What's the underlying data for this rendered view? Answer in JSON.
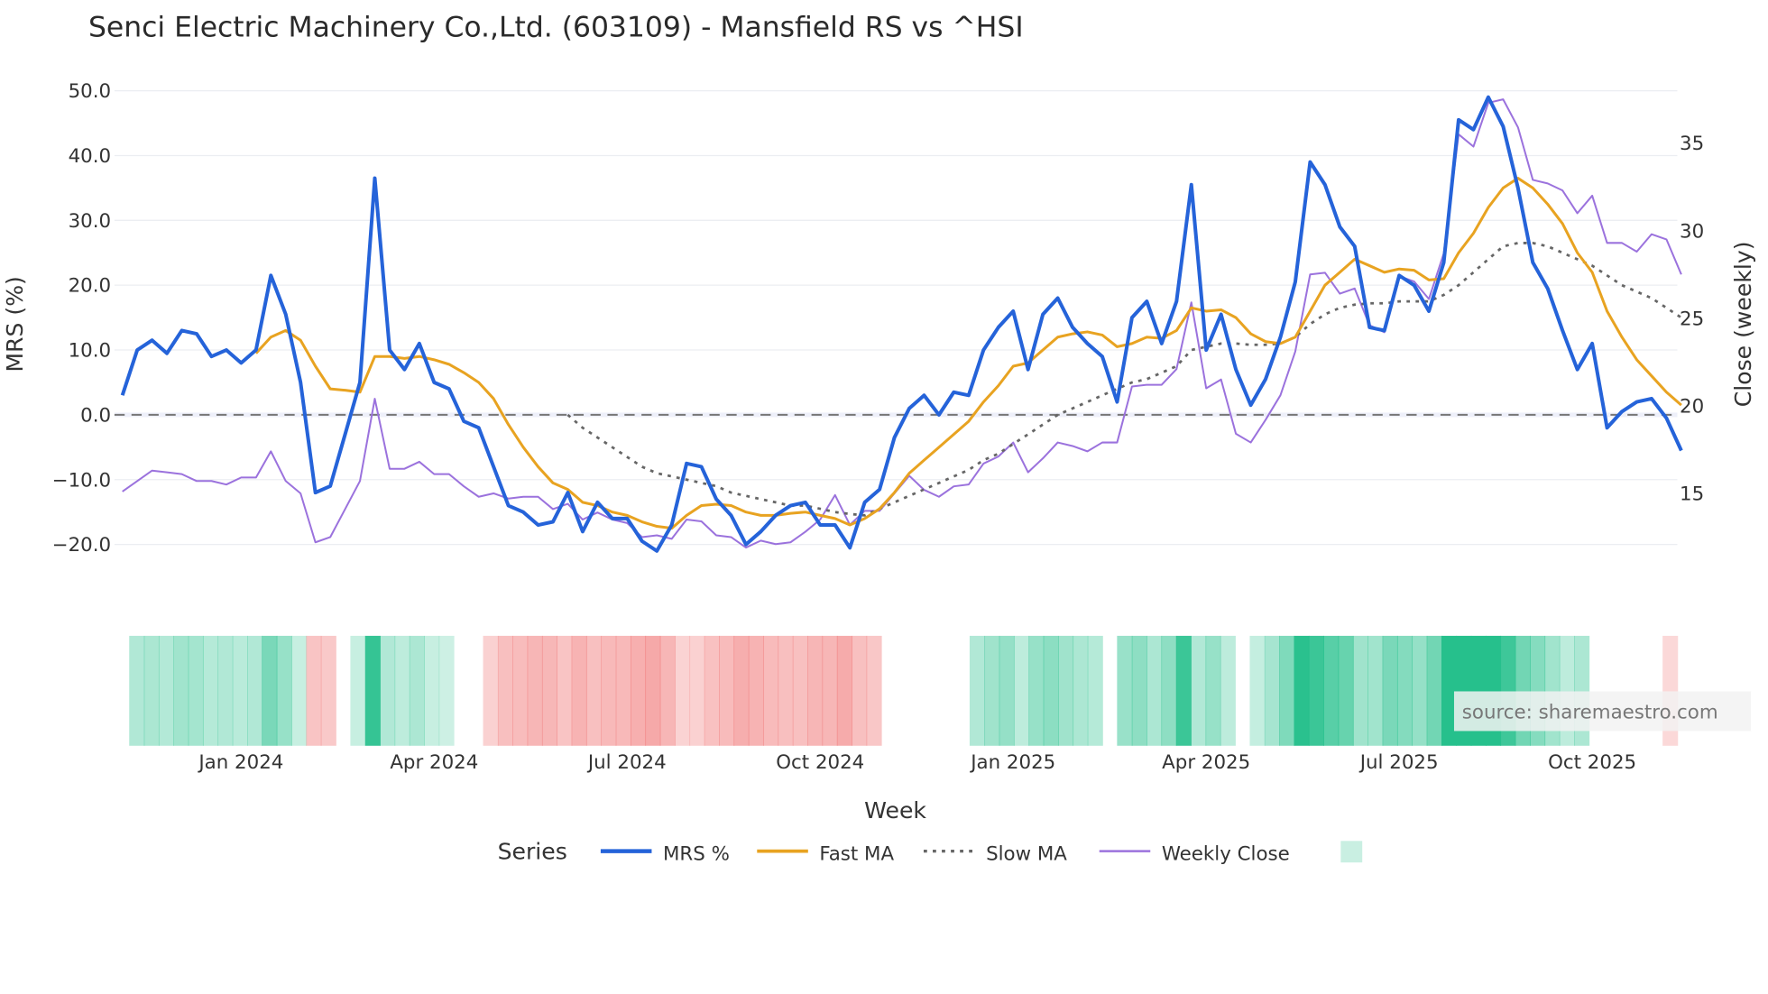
{
  "chart_data": {
    "type": "line",
    "title": "Senci Electric Machinery Co.,Ltd. (603109) - Mansfield RS vs ^HSI",
    "xlabel": "Week",
    "ylabel_left": "MRS (%)",
    "ylabel_right": "Close (weekly)",
    "ylim_left": [
      -25,
      52
    ],
    "ylim_right": [
      11,
      38.5
    ],
    "yticks_left": [
      "50.0",
      "40.0",
      "30.0",
      "20.0",
      "10.0",
      "0.0",
      "−10.0",
      "−20.0"
    ],
    "yticks_left_values": [
      50,
      40,
      30,
      20,
      10,
      0,
      -10,
      -20
    ],
    "yticks_right": [
      "35",
      "30",
      "25",
      "20",
      "15"
    ],
    "yticks_right_values": [
      35,
      30,
      25,
      20,
      15
    ],
    "xticks": [
      "Jan 2024",
      "Apr 2024",
      "Jul 2024",
      "Oct 2024",
      "Jan 2025",
      "Apr 2025",
      "Jul 2025",
      "Oct 2025"
    ],
    "xticks_week_index": [
      8,
      21,
      34,
      47,
      60,
      73,
      86,
      99
    ],
    "first_week": "2023-11-06",
    "grid": true,
    "zero_line": true,
    "legend_title": "Series",
    "legend_placement": "bottom",
    "source_note": "source: sharemaestro.com",
    "colors": {
      "mrs": "#2563d9",
      "fast": "#e8a321",
      "slow": "#666666",
      "close": "#9b72dd",
      "pos": "#26c08c",
      "neg": "#f07070"
    },
    "series": [
      {
        "name": "MRS %",
        "axis": "left",
        "start": 0,
        "values": [
          3,
          10,
          11.5,
          9.5,
          13,
          12.5,
          9,
          10,
          8,
          10,
          21.5,
          15.5,
          5,
          -12,
          -11,
          -3,
          5,
          36.5,
          10,
          7,
          11,
          5,
          4,
          -1,
          -2,
          -8,
          -14,
          -15,
          -17,
          -16.5,
          -12,
          -18,
          -13.5,
          -16,
          -16,
          -19.5,
          -21,
          -17,
          -7.5,
          -8,
          -13,
          -15.5,
          -20,
          -18,
          -15.5,
          -14,
          -13.5,
          -17,
          -17,
          -20.5,
          -13.5,
          -11.5,
          -3.5,
          1,
          3,
          0,
          3.5,
          3,
          10,
          13.5,
          16,
          7,
          15.5,
          18,
          13.5,
          11,
          9,
          2,
          15,
          17.5,
          11,
          17.5,
          35.5,
          10,
          15.5,
          7,
          1.5,
          5.5,
          12,
          20.5,
          39,
          35.5,
          29,
          26,
          13.5,
          13,
          21.5,
          20,
          16,
          23.5,
          45.5,
          44,
          49,
          44.5,
          35,
          23.5,
          19.5,
          13,
          7,
          11,
          -2,
          0.5,
          2,
          2.5,
          -0.5,
          -5.5
        ]
      },
      {
        "name": "Fast MA",
        "axis": "left",
        "start": 9,
        "values": [
          9.5,
          12,
          13,
          11.5,
          7.5,
          4,
          3.8,
          3.5,
          9,
          9,
          8.7,
          9,
          8.5,
          7.8,
          6.5,
          5,
          2.5,
          -1.5,
          -5,
          -8,
          -10.5,
          -11.5,
          -13.5,
          -14,
          -15,
          -15.5,
          -16.5,
          -17.2,
          -17.5,
          -15.5,
          -14,
          -13.8,
          -14,
          -15,
          -15.5,
          -15.5,
          -15.2,
          -15,
          -15.5,
          -16,
          -17,
          -16,
          -14.5,
          -12,
          -9,
          -7,
          -5,
          -3,
          -1,
          2,
          4.5,
          7.5,
          8,
          10,
          12,
          12.5,
          12.8,
          12.3,
          10.5,
          11,
          12,
          11.8,
          13,
          16.5,
          16,
          16.2,
          15,
          12.5,
          11.3,
          11,
          12,
          16,
          20,
          22,
          24,
          23,
          22,
          22.5,
          22.3,
          20.8,
          21,
          25,
          28,
          32,
          35,
          36.5,
          35,
          32.5,
          29.5,
          25,
          22,
          16,
          12,
          8.5,
          6,
          3.5,
          1.5
        ]
      },
      {
        "name": "Slow MA",
        "axis": "left",
        "start": 30,
        "values": [
          0,
          -2,
          -3.5,
          -5,
          -6.5,
          -8,
          -9,
          -9.5,
          -10,
          -10.5,
          -11,
          -12,
          -12.5,
          -13,
          -13.5,
          -14,
          -14,
          -14.5,
          -15,
          -15.3,
          -15.5,
          -14.5,
          -13.5,
          -12.5,
          -11.5,
          -10.5,
          -9.5,
          -8.5,
          -7,
          -6,
          -4.5,
          -3,
          -1.5,
          0,
          1,
          2,
          3,
          4,
          5,
          5.5,
          6.5,
          7.5,
          10,
          10.5,
          11,
          11,
          10.8,
          10.8,
          11,
          12,
          14,
          15.5,
          16.5,
          17,
          17.2,
          17.2,
          17.5,
          17.5,
          17.5,
          18.5,
          20,
          22,
          24,
          26,
          26.5,
          26.5,
          26,
          25,
          24,
          23,
          21.5,
          20,
          19,
          18,
          16.5,
          15
        ]
      },
      {
        "name": "Weekly Close",
        "axis": "right",
        "start": 0,
        "values": [
          15.1,
          15.7,
          16.3,
          16.2,
          16.1,
          15.7,
          15.7,
          15.5,
          15.9,
          15.9,
          17.4,
          15.7,
          15.0,
          12.2,
          12.5,
          14.1,
          15.7,
          20.4,
          16.4,
          16.4,
          16.8,
          16.1,
          16.1,
          15.4,
          14.8,
          15.0,
          14.7,
          14.8,
          14.8,
          14.1,
          14.4,
          13.5,
          13.9,
          13.5,
          13.3,
          12.5,
          12.6,
          12.4,
          13.5,
          13.4,
          12.6,
          12.5,
          11.9,
          12.3,
          12.1,
          12.2,
          12.8,
          13.5,
          14.9,
          13.2,
          14.0,
          14.0,
          15.0,
          16.0,
          15.2,
          14.8,
          15.4,
          15.5,
          16.7,
          17.1,
          17.9,
          16.2,
          17.0,
          17.9,
          17.7,
          17.4,
          17.9,
          17.9,
          21.1,
          21.2,
          21.2,
          22.1,
          25.9,
          21.0,
          21.5,
          18.4,
          17.9,
          19.2,
          20.6,
          23.1,
          27.5,
          27.6,
          26.4,
          26.7,
          24.6,
          24.2,
          27.4,
          27.1,
          26.1,
          28.7,
          35.5,
          34.8,
          37.3,
          37.5,
          35.9,
          32.9,
          32.7,
          32.3,
          31.0,
          32.0,
          29.3,
          29.3,
          28.8,
          29.8,
          29.5,
          27.5
        ]
      }
    ]
  }
}
